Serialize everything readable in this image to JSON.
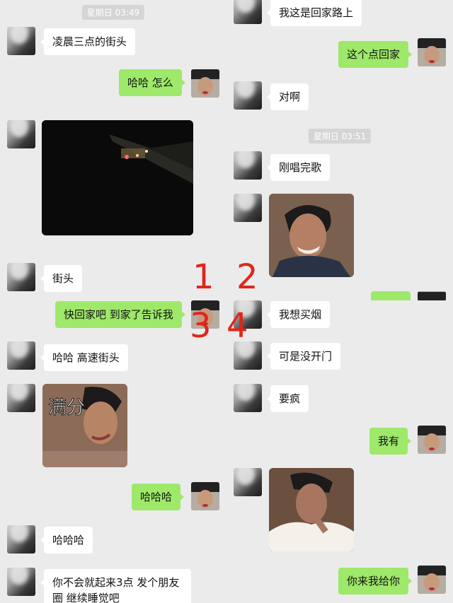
{
  "timestamps": {
    "q1": "星期日 03:49",
    "q2": "星期日 03:51"
  },
  "messages": {
    "q1_m1": "凌晨三点的街头",
    "q1_m2": "哈哈 怎么",
    "q1_m3": "街头",
    "q2_m1": "我这是回家路上",
    "q2_m2": "这个点回家",
    "q2_m3": "对啊",
    "q2_m4": "刚唱完歌",
    "q3_m1": "快回家吧 到家了告诉我",
    "q3_m2": "哈哈 高速街头",
    "q3_m3": "哈哈哈",
    "q3_m4": "哈哈哈",
    "q3_m5": "你不会就起来3点 发个朋友圈 继续睡觉吧",
    "q4_m1": "我想买烟",
    "q4_m2": "可是没开门",
    "q4_m3": "要疯",
    "q4_m4": "我有",
    "q4_m5": "你来我给你"
  },
  "sticker_text": "满分",
  "quadrant_numbers": [
    "1",
    "2",
    "3",
    "4"
  ],
  "colors": {
    "outgoing_bubble": "#9ee86a",
    "incoming_bubble": "#ffffff",
    "background": "#ebebeb",
    "annotation": "#e0261a"
  },
  "icons": [
    "avatar",
    "video-thumbnail",
    "sticker"
  ]
}
